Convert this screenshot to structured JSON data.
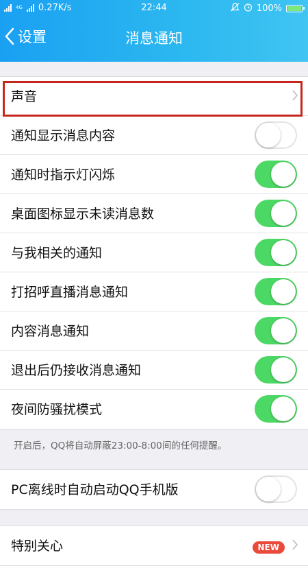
{
  "status_bar": {
    "left_text": "0.27K/s",
    "net_tag": "4G",
    "time": "22:44",
    "battery": "100%"
  },
  "nav": {
    "back_label": "设置",
    "title": "消息通知"
  },
  "colors": {
    "header_start": "#1aa0f2",
    "header_end": "#40c4f2",
    "toggle_on": "#4cd864",
    "highlight": "#c7261c",
    "new_badge": "#e94a3a"
  },
  "main": {
    "sound_label": "声音",
    "settings": [
      {
        "label": "通知显示消息内容",
        "enabled": false
      },
      {
        "label": "通知时指示灯闪烁",
        "enabled": true
      },
      {
        "label": "桌面图标显示未读消息数",
        "enabled": true
      },
      {
        "label": "与我相关的通知",
        "enabled": true
      },
      {
        "label": "打招呼直播消息通知",
        "enabled": true
      },
      {
        "label": "内容消息通知",
        "enabled": true
      },
      {
        "label": "退出后仍接收消息通知",
        "enabled": true
      },
      {
        "label": "夜间防骚扰模式",
        "enabled": true
      }
    ],
    "dnd_hint": "开启后，QQ将自动屏蔽23:00-8:00间的任何提醒。",
    "pc_offline": {
      "label": "PC离线时自动启动QQ手机版",
      "enabled": false
    },
    "special_care": {
      "label": "特别关心",
      "badge": "NEW"
    }
  }
}
